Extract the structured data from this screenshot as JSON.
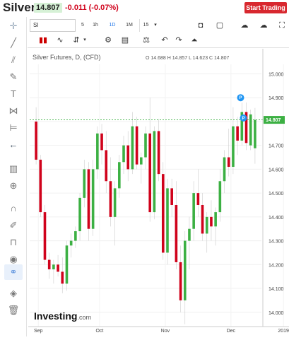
{
  "header": {
    "symbol": "Silver",
    "price": "14.807",
    "change": "-0.011 (-0.07%)",
    "start_trading": "Start Trading"
  },
  "toolbar": {
    "symbol_input": "SI",
    "timeframes": [
      "5",
      "1h",
      "1D",
      "1M",
      "15"
    ],
    "active_timeframe": "1D",
    "timeframe_dropdown_icon": "chevron-down-icon"
  },
  "legend": {
    "instrument": "Silver Futures, D, (CFD)",
    "ohlc": "O 14.688  H 14.857  L 14.623  C 14.807"
  },
  "last_price_label": "14.807",
  "watermark": "Investing",
  "watermark_suffix": ".com",
  "colors": {
    "up": "#3cb043",
    "down": "#d0021b",
    "last_line": "#3cb043",
    "marker": "#2196f3"
  },
  "chart_data": {
    "type": "candlestick",
    "y_ticks": [
      "15.000",
      "14.900",
      "14.800",
      "14.700",
      "14.600",
      "14.500",
      "14.400",
      "14.300",
      "14.200",
      "14.100",
      "14.000"
    ],
    "x_ticks": [
      "Sep",
      "Oct",
      "Nov",
      "Dec",
      "2019"
    ],
    "ylim": [
      13.94,
      15.04
    ],
    "last_price": 14.807,
    "candles": [
      {
        "o": 14.8,
        "h": 14.86,
        "l": 14.62,
        "c": 14.64
      },
      {
        "o": 14.64,
        "h": 14.66,
        "l": 14.4,
        "c": 14.42
      },
      {
        "o": 14.42,
        "h": 14.45,
        "l": 14.2,
        "c": 14.22
      },
      {
        "o": 14.22,
        "h": 14.25,
        "l": 14.14,
        "c": 14.18
      },
      {
        "o": 14.18,
        "h": 14.22,
        "l": 14.12,
        "c": 14.2
      },
      {
        "o": 14.2,
        "h": 14.24,
        "l": 14.15,
        "c": 14.17
      },
      {
        "o": 14.17,
        "h": 14.23,
        "l": 14.08,
        "c": 14.12
      },
      {
        "o": 14.12,
        "h": 14.3,
        "l": 14.09,
        "c": 14.28
      },
      {
        "o": 14.28,
        "h": 14.33,
        "l": 14.23,
        "c": 14.3
      },
      {
        "o": 14.3,
        "h": 14.36,
        "l": 14.27,
        "c": 14.34
      },
      {
        "o": 14.34,
        "h": 14.5,
        "l": 14.3,
        "c": 14.48
      },
      {
        "o": 14.48,
        "h": 14.64,
        "l": 14.44,
        "c": 14.6
      },
      {
        "o": 14.6,
        "h": 14.63,
        "l": 14.3,
        "c": 14.35
      },
      {
        "o": 14.35,
        "h": 14.64,
        "l": 14.32,
        "c": 14.6
      },
      {
        "o": 14.6,
        "h": 14.78,
        "l": 14.56,
        "c": 14.75
      },
      {
        "o": 14.75,
        "h": 14.79,
        "l": 14.62,
        "c": 14.68
      },
      {
        "o": 14.68,
        "h": 14.76,
        "l": 14.5,
        "c": 14.55
      },
      {
        "o": 14.55,
        "h": 14.65,
        "l": 14.36,
        "c": 14.4
      },
      {
        "o": 14.4,
        "h": 14.55,
        "l": 14.28,
        "c": 14.52
      },
      {
        "o": 14.52,
        "h": 14.66,
        "l": 14.48,
        "c": 14.63
      },
      {
        "o": 14.63,
        "h": 14.74,
        "l": 14.58,
        "c": 14.7
      },
      {
        "o": 14.7,
        "h": 14.76,
        "l": 14.55,
        "c": 14.6
      },
      {
        "o": 14.6,
        "h": 14.84,
        "l": 14.58,
        "c": 14.78
      },
      {
        "o": 14.78,
        "h": 14.82,
        "l": 14.6,
        "c": 14.62
      },
      {
        "o": 14.62,
        "h": 14.67,
        "l": 14.54,
        "c": 14.65
      },
      {
        "o": 14.65,
        "h": 14.78,
        "l": 14.6,
        "c": 14.75
      },
      {
        "o": 14.75,
        "h": 14.9,
        "l": 14.38,
        "c": 14.42
      },
      {
        "o": 14.42,
        "h": 14.78,
        "l": 14.39,
        "c": 14.76
      },
      {
        "o": 14.76,
        "h": 14.81,
        "l": 14.55,
        "c": 14.58
      },
      {
        "o": 14.58,
        "h": 14.63,
        "l": 14.22,
        "c": 14.25
      },
      {
        "o": 14.25,
        "h": 14.56,
        "l": 14.2,
        "c": 14.52
      },
      {
        "o": 14.52,
        "h": 14.56,
        "l": 14.4,
        "c": 14.45
      },
      {
        "o": 14.45,
        "h": 14.55,
        "l": 14.18,
        "c": 14.21
      },
      {
        "o": 14.21,
        "h": 14.28,
        "l": 14.0,
        "c": 14.05
      },
      {
        "o": 14.05,
        "h": 14.34,
        "l": 13.95,
        "c": 14.3
      },
      {
        "o": 14.3,
        "h": 14.4,
        "l": 14.18,
        "c": 14.35
      },
      {
        "o": 14.35,
        "h": 14.55,
        "l": 14.3,
        "c": 14.5
      },
      {
        "o": 14.5,
        "h": 14.6,
        "l": 14.4,
        "c": 14.45
      },
      {
        "o": 14.45,
        "h": 14.5,
        "l": 14.3,
        "c": 14.33
      },
      {
        "o": 14.33,
        "h": 14.42,
        "l": 14.25,
        "c": 14.4
      },
      {
        "o": 14.4,
        "h": 14.47,
        "l": 14.3,
        "c": 14.36
      },
      {
        "o": 14.36,
        "h": 14.44,
        "l": 14.28,
        "c": 14.42
      },
      {
        "o": 14.42,
        "h": 14.6,
        "l": 14.38,
        "c": 14.55
      },
      {
        "o": 14.55,
        "h": 14.68,
        "l": 14.5,
        "c": 14.65
      },
      {
        "o": 14.65,
        "h": 14.77,
        "l": 14.57,
        "c": 14.61
      },
      {
        "o": 14.61,
        "h": 14.86,
        "l": 14.58,
        "c": 14.78
      },
      {
        "o": 14.78,
        "h": 14.82,
        "l": 14.66,
        "c": 14.72
      },
      {
        "o": 14.72,
        "h": 14.88,
        "l": 14.7,
        "c": 14.84
      },
      {
        "o": 14.84,
        "h": 14.88,
        "l": 14.68,
        "c": 14.71
      },
      {
        "o": 14.7,
        "h": 14.85,
        "l": 14.68,
        "c": 14.83
      },
      {
        "o": 14.688,
        "h": 14.857,
        "l": 14.623,
        "c": 14.807
      }
    ]
  }
}
